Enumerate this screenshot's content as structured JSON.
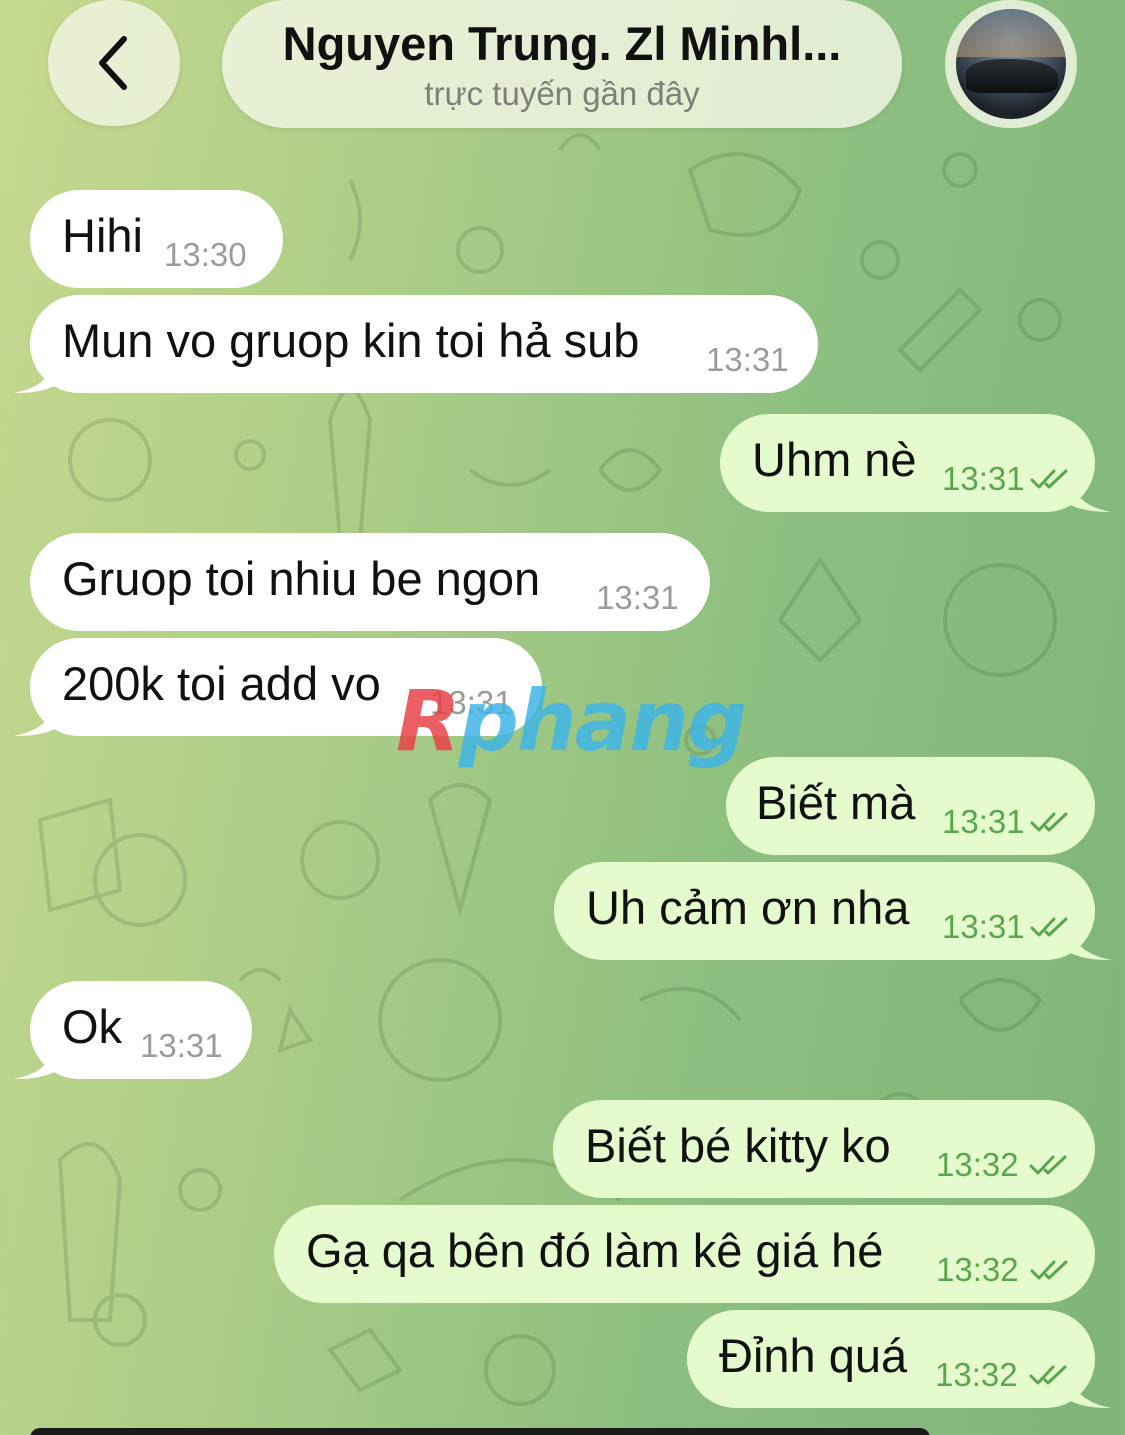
{
  "header": {
    "back_icon": "chevron-left-icon",
    "contact_name": "Nguyen Trung. Zl Minhl...",
    "status": "trực tuyến gần đây",
    "avatar": "sports-car-avatar"
  },
  "messages": [
    {
      "dir": "in",
      "text": "Hihi",
      "time": "13:30"
    },
    {
      "dir": "in",
      "text": "Mun vo gruop kin toi hả sub",
      "time": "13:31"
    },
    {
      "dir": "out",
      "text": "Uhm nè",
      "time": "13:31",
      "read": true
    },
    {
      "dir": "in",
      "text": "Gruop toi nhiu be ngon",
      "time": "13:31"
    },
    {
      "dir": "in",
      "text": "200k toi add vo",
      "time": "13:31"
    },
    {
      "dir": "out",
      "text": "Biết mà",
      "time": "13:31",
      "read": true
    },
    {
      "dir": "out",
      "text": "Uh cảm ơn nha",
      "time": "13:31",
      "read": true
    },
    {
      "dir": "in",
      "text": "Ok",
      "time": "13:31"
    },
    {
      "dir": "out",
      "text": "Biết bé kitty ko",
      "time": "13:32",
      "read": true
    },
    {
      "dir": "out",
      "text": "Gạ qa bên đó làm kê giá hé",
      "time": "13:32",
      "read": true
    },
    {
      "dir": "out",
      "text": "Đỉnh quá",
      "time": "13:32",
      "read": true
    }
  ],
  "watermark": {
    "first": "R",
    "rest": "phang"
  },
  "colors": {
    "incoming_bubble": "#ffffff",
    "outgoing_bubble": "#e5fbcd",
    "outgoing_time": "#5aa64e",
    "incoming_time": "#9a9c98"
  }
}
